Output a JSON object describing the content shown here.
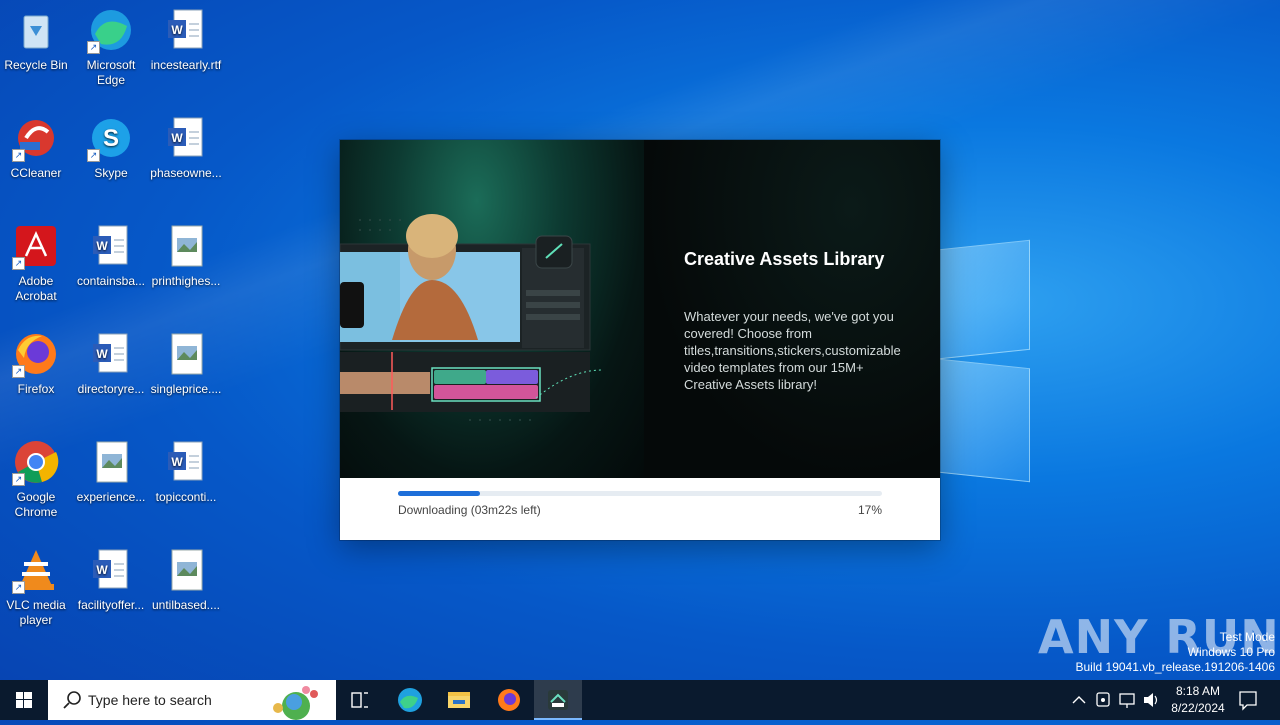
{
  "desktop": {
    "icons": [
      {
        "label": "Recycle Bin",
        "icon": "recycle-bin-icon"
      },
      {
        "label": "Microsoft Edge",
        "icon": "edge-icon"
      },
      {
        "label": "incestearly.rtf",
        "icon": "word-doc-icon"
      },
      {
        "label": "CCleaner",
        "icon": "ccleaner-icon"
      },
      {
        "label": "Skype",
        "icon": "skype-icon"
      },
      {
        "label": "phaseowne...",
        "icon": "word-doc-icon"
      },
      {
        "label": "Adobe Acrobat",
        "icon": "acrobat-icon"
      },
      {
        "label": "containsba...",
        "icon": "word-doc-icon"
      },
      {
        "label": "printhighes...",
        "icon": "image-file-icon"
      },
      {
        "label": "Firefox",
        "icon": "firefox-icon"
      },
      {
        "label": "directoryre...",
        "icon": "word-doc-icon"
      },
      {
        "label": "singleprice....",
        "icon": "image-file-icon"
      },
      {
        "label": "Google Chrome",
        "icon": "chrome-icon"
      },
      {
        "label": "experience...",
        "icon": "image-file-icon"
      },
      {
        "label": "topicconti...",
        "icon": "word-doc-icon"
      },
      {
        "label": "VLC media player",
        "icon": "vlc-icon"
      },
      {
        "label": "facilityoffer...",
        "icon": "word-doc-icon"
      },
      {
        "label": "untilbased....",
        "icon": "image-file-icon"
      }
    ]
  },
  "installer": {
    "title": "Creative Assets Library",
    "description": "Whatever your needs, we've got you covered! Choose from titles,transitions,stickers,customizable video templates from our 15M+ Creative Assets library!",
    "status": "Downloading (03m22s left)",
    "percent_label": "17%",
    "progress": 0.17
  },
  "taskbar": {
    "search_placeholder": "Type here to search",
    "time": "8:18 AM",
    "date": "8/22/2024"
  },
  "watermark": {
    "line1": "Test Mode",
    "line2": "Windows 10 Pro",
    "line3": "Build 19041.vb_release.191206-1406",
    "brand": "ANY RUN"
  },
  "colors": {
    "accent": "#1e6fd9",
    "taskbar": "#0a1a2e"
  }
}
